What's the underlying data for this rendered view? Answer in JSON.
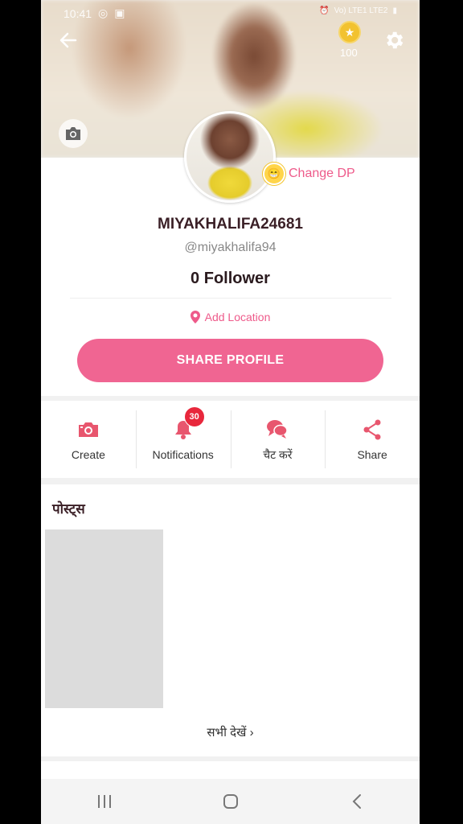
{
  "status_bar": {
    "time": "10:41",
    "right_text": "Vo) LTE1 LTE2"
  },
  "header": {
    "coins": "100"
  },
  "profile": {
    "change_dp_label": "Change DP",
    "username": "MIYAKHALIFA24681",
    "handle": "@miyakhalifa94",
    "followers": "0 Follower",
    "location_label": "Add Location",
    "share_profile_label": "SHARE PROFILE"
  },
  "actions": [
    {
      "label": "Create",
      "icon": "camera-icon"
    },
    {
      "label": "Notifications",
      "icon": "bell-icon",
      "badge": "30"
    },
    {
      "label": "चैट करें",
      "icon": "chat-icon"
    },
    {
      "label": "Share",
      "icon": "share-icon"
    }
  ],
  "posts": {
    "title": "पोस्ट्स",
    "see_all_label": "सभी देखें"
  },
  "colors": {
    "accent": "#f06592",
    "pink_text": "#ee5a8a",
    "badge": "#e8273c"
  }
}
